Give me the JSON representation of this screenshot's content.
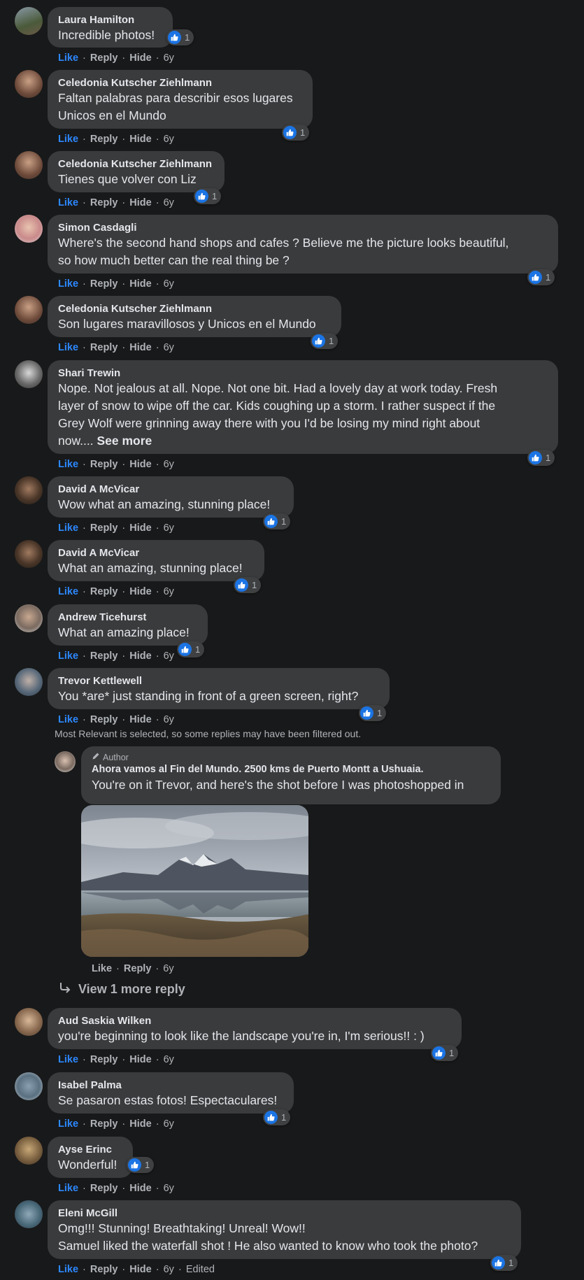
{
  "actions": {
    "like": "Like",
    "reply": "Reply",
    "hide": "Hide",
    "time": "6y",
    "edited": "Edited"
  },
  "comments": [
    {
      "name": "Laura Hamilton",
      "text": "Incredible photos!",
      "reactions": "1"
    },
    {
      "name": "Celedonia Kutscher Ziehlmann",
      "text": "Faltan palabras para describir esos lugares\nUnicos en el Mundo",
      "reactions": "1"
    },
    {
      "name": "Celedonia Kutscher Ziehlmann",
      "text": "Tienes que volver con Liz",
      "reactions": "1"
    },
    {
      "name": "Simon Casdagli",
      "text": "Where's the second hand shops and cafes ? Believe me the picture looks beautiful,\nso how much better can the real thing be ?",
      "reactions": "1"
    },
    {
      "name": "Celedonia Kutscher Ziehlmann",
      "text": "Son lugares maravillosos y Unicos en el Mundo",
      "reactions": "1"
    },
    {
      "name": "Shari Trewin",
      "text": "Nope. Not jealous at all. Nope. Not one bit. Had a lovely day at work today. Fresh\nlayer of snow to wipe off the car. Kids coughing up a storm. I rather suspect if the\nGrey Wolf were grinning away there with you I'd be losing my mind right about\nnow.... ",
      "see_more": "See more",
      "reactions": "1"
    },
    {
      "name": "David A McVicar",
      "text": "Wow what an amazing, stunning place!",
      "reactions": "1"
    },
    {
      "name": "David A McVicar",
      "text": "What an amazing, stunning place!",
      "reactions": "1"
    },
    {
      "name": "Andrew Ticehurst",
      "text": "What an amazing place!",
      "reactions": "1"
    },
    {
      "name": "Trevor Kettlewell",
      "text": "You *are* just standing in front of a green screen, right?",
      "reactions": "1"
    },
    {
      "name": "Aud Saskia Wilken",
      "text": "you're beginning to look like the landscape you're in, I'm serious!! : )",
      "reactions": "1"
    },
    {
      "name": "Isabel Palma",
      "text": "Se pasaron estas fotos! Espectaculares!",
      "reactions": "1"
    },
    {
      "name": "Ayse Erinc",
      "text": "Wonderful!",
      "reactions": "1"
    },
    {
      "name": "Eleni McGill",
      "text": "Omg!!! Stunning! Breathtaking! Unreal! Wow!!\nSamuel liked the waterfall shot ! He also wanted to know who took the photo?",
      "reactions": "1"
    }
  ],
  "filter_notice": "Most Relevant is selected, so some replies may have been filtered out.",
  "author_reply": {
    "badge": "Author",
    "name": "Ahora vamos al Fin del Mundo. 2500 kms de Puerto Montt a Ushuaia.",
    "text": "You're on it Trevor, and here's the shot before I was photoshopped in",
    "actions": {
      "like": "Like",
      "reply": "Reply",
      "time": "6y"
    }
  },
  "view_more": "View 1 more reply",
  "colors": {
    "background": "#18191a",
    "bubble": "#3a3b3c",
    "like_blue": "#2d88ff",
    "muted": "#b0b3b8"
  }
}
